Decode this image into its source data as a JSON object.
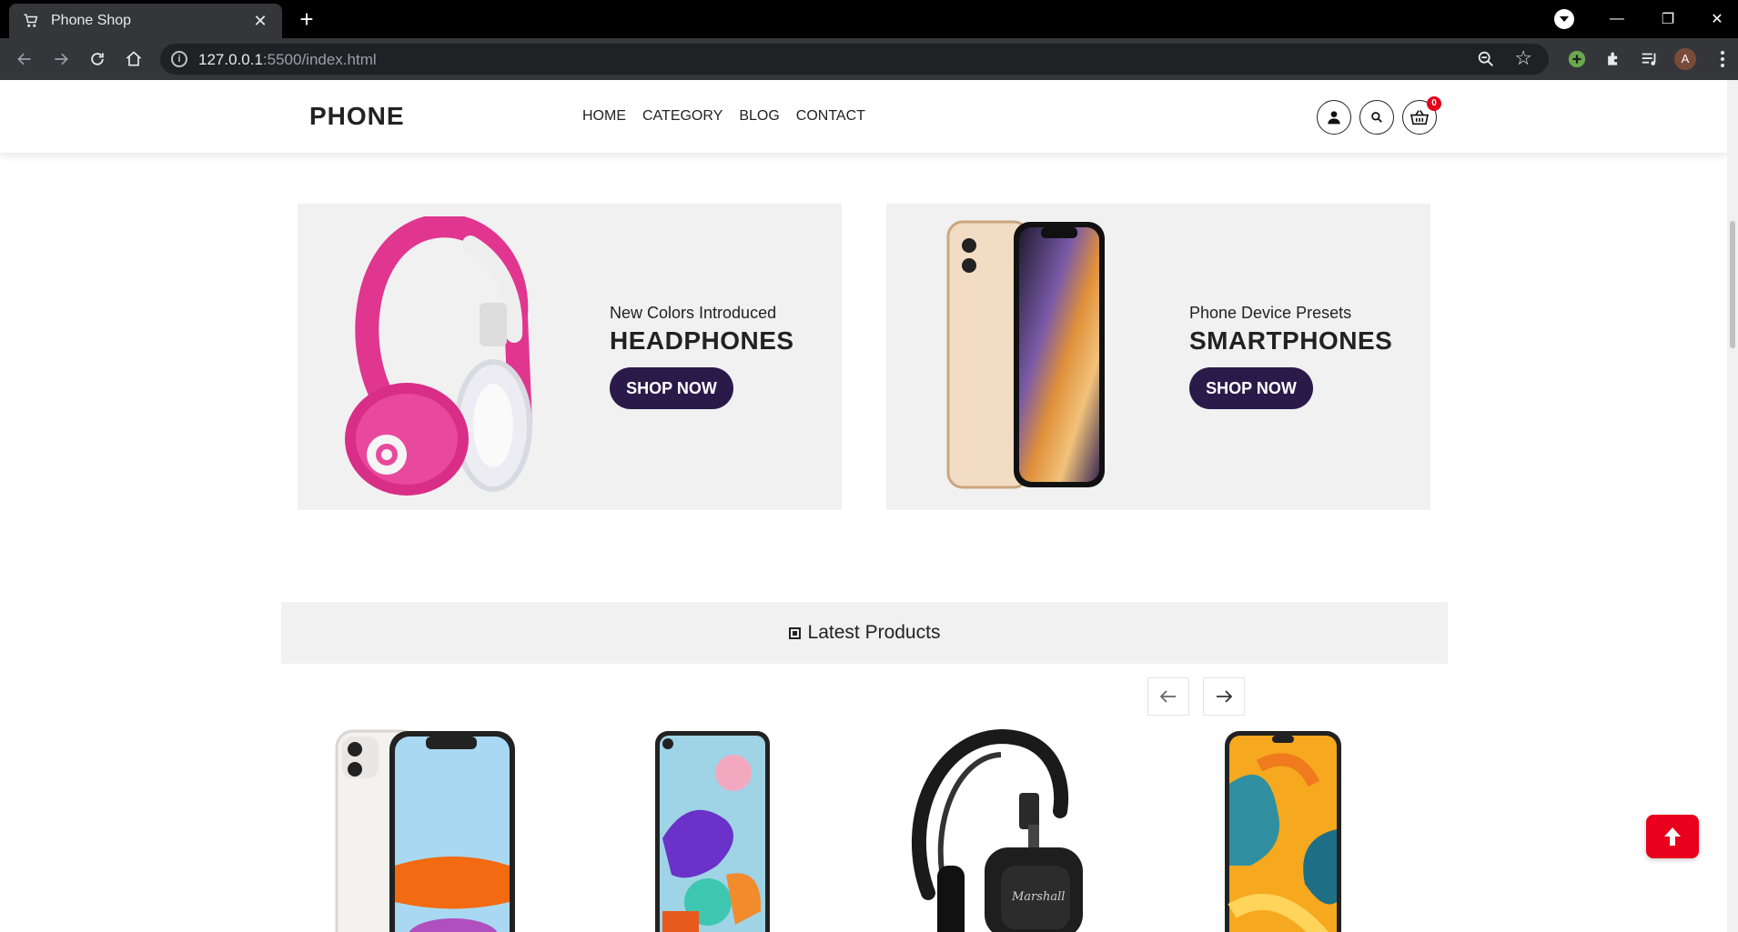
{
  "browser": {
    "tab_title": "Phone Shop",
    "url_host": "127.0.0.1",
    "url_rest": ":5500/index.html",
    "profile_initial": "A"
  },
  "site": {
    "logo": "PHONE",
    "nav": [
      {
        "label": "HOME"
      },
      {
        "label": "CATEGORY"
      },
      {
        "label": "BLOG"
      },
      {
        "label": "CONTACT"
      }
    ],
    "cart_count": "0"
  },
  "banners": [
    {
      "subtitle": "New Colors Introduced",
      "heading": "HEADPHONES",
      "button": "SHOP NOW"
    },
    {
      "subtitle": "Phone Device Presets",
      "heading": "SMARTPHONES",
      "button": "SHOP NOW"
    }
  ],
  "latest": {
    "title": "Latest Products"
  },
  "colors": {
    "accent": "#2a1a4a",
    "badge": "#e2001a",
    "to_top": "#e8001c",
    "panel": "#f1f1f1"
  }
}
